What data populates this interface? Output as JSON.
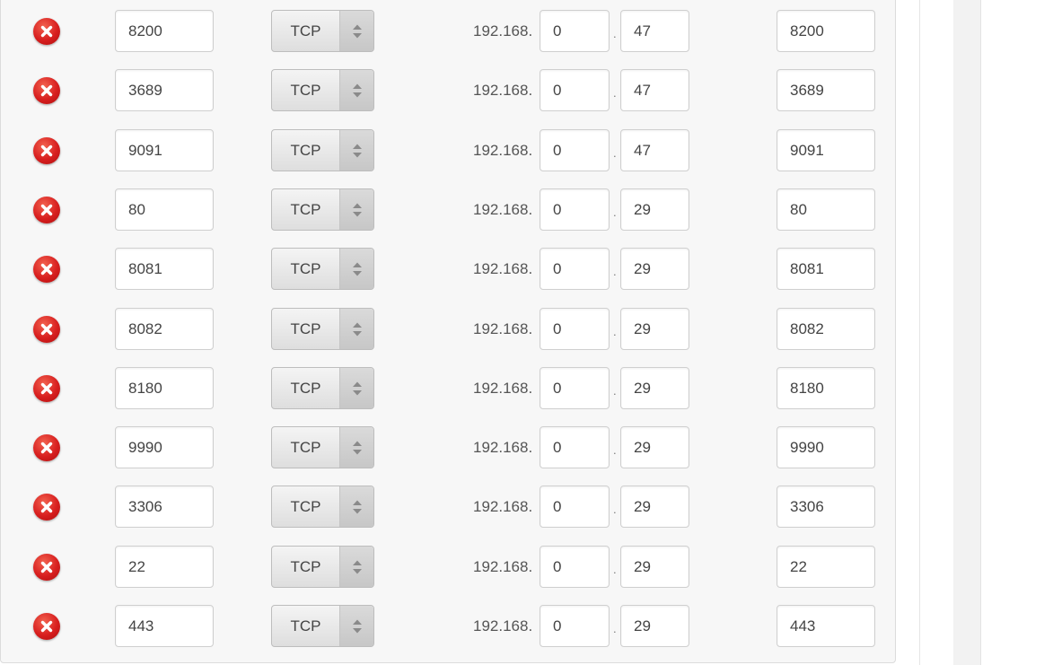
{
  "separators": {
    "ip_prefix": "192.168.",
    "octet_dot": "."
  },
  "colors": {
    "delete_red": "#d81f1f",
    "panel_bg": "#f7f7f7",
    "field_border": "#cfcfcf"
  },
  "rules": [
    {
      "external_port": "8200",
      "protocol": "TCP",
      "ip_octet3": "0",
      "ip_octet4": "47",
      "internal_port": "8200"
    },
    {
      "external_port": "3689",
      "protocol": "TCP",
      "ip_octet3": "0",
      "ip_octet4": "47",
      "internal_port": "3689"
    },
    {
      "external_port": "9091",
      "protocol": "TCP",
      "ip_octet3": "0",
      "ip_octet4": "47",
      "internal_port": "9091"
    },
    {
      "external_port": "80",
      "protocol": "TCP",
      "ip_octet3": "0",
      "ip_octet4": "29",
      "internal_port": "80"
    },
    {
      "external_port": "8081",
      "protocol": "TCP",
      "ip_octet3": "0",
      "ip_octet4": "29",
      "internal_port": "8081"
    },
    {
      "external_port": "8082",
      "protocol": "TCP",
      "ip_octet3": "0",
      "ip_octet4": "29",
      "internal_port": "8082"
    },
    {
      "external_port": "8180",
      "protocol": "TCP",
      "ip_octet3": "0",
      "ip_octet4": "29",
      "internal_port": "8180"
    },
    {
      "external_port": "9990",
      "protocol": "TCP",
      "ip_octet3": "0",
      "ip_octet4": "29",
      "internal_port": "9990"
    },
    {
      "external_port": "3306",
      "protocol": "TCP",
      "ip_octet3": "0",
      "ip_octet4": "29",
      "internal_port": "3306"
    },
    {
      "external_port": "22",
      "protocol": "TCP",
      "ip_octet3": "0",
      "ip_octet4": "29",
      "internal_port": "22"
    },
    {
      "external_port": "443",
      "protocol": "TCP",
      "ip_octet3": "0",
      "ip_octet4": "29",
      "internal_port": "443"
    }
  ]
}
